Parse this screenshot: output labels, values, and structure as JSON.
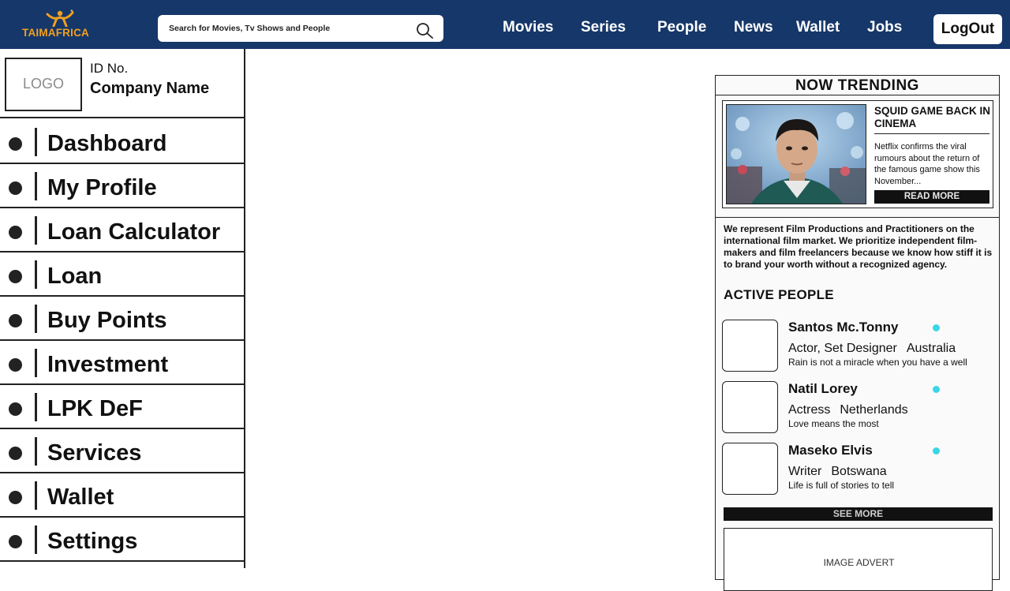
{
  "brand": {
    "name": "TAIMAFRICA",
    "accent": "#f0a020",
    "bar_color": "#163769"
  },
  "search": {
    "placeholder": "Search for Movies, Tv Shows and People",
    "icon": "search-icon"
  },
  "nav": [
    {
      "label": "Movies"
    },
    {
      "label": "Series"
    },
    {
      "label": "People"
    },
    {
      "label": "News"
    },
    {
      "label": "Wallet"
    },
    {
      "label": "Jobs"
    }
  ],
  "logout_label": "LogOut",
  "sidebar": {
    "logo_label": "LOGO",
    "id_label": "ID No.",
    "company_name": "Company Name",
    "items": [
      {
        "label": "Dashboard"
      },
      {
        "label": "My Profile"
      },
      {
        "label": "Loan Calculator"
      },
      {
        "label": "Loan"
      },
      {
        "label": "Buy Points"
      },
      {
        "label": "Investment"
      },
      {
        "label": "LPK DeF"
      },
      {
        "label": "Services"
      },
      {
        "label": "Wallet"
      },
      {
        "label": "Settings"
      }
    ]
  },
  "trending": {
    "title": "NOW TRENDING",
    "headline": "SQUID GAME BACK IN CINEMA",
    "body": "Netflix confirms the viral rumours about the return of the famous game show this November...",
    "read_more": "READ MORE"
  },
  "intro": "We represent Film Productions and Practitioners on the international film market. We prioritize independent film-makers and film freelancers because we know how stiff it is to brand your worth without a recognized agency.",
  "active_people": {
    "title": "ACTIVE PEOPLE",
    "status_color": "#39d6e6",
    "people": [
      {
        "name": "Santos Mc.Tonny",
        "role": "Actor, Set Designer",
        "country": "Australia",
        "quote": "Rain is not a miracle when you have a well"
      },
      {
        "name": "Natil Lorey",
        "role": "Actress",
        "country": "Netherlands",
        "quote": "Love means the most"
      },
      {
        "name": "Maseko Elvis",
        "role": "Writer",
        "country": "Botswana",
        "quote": "Life is full of stories to tell"
      }
    ],
    "see_more": "SEE MORE"
  },
  "advert_label": "IMAGE ADVERT"
}
